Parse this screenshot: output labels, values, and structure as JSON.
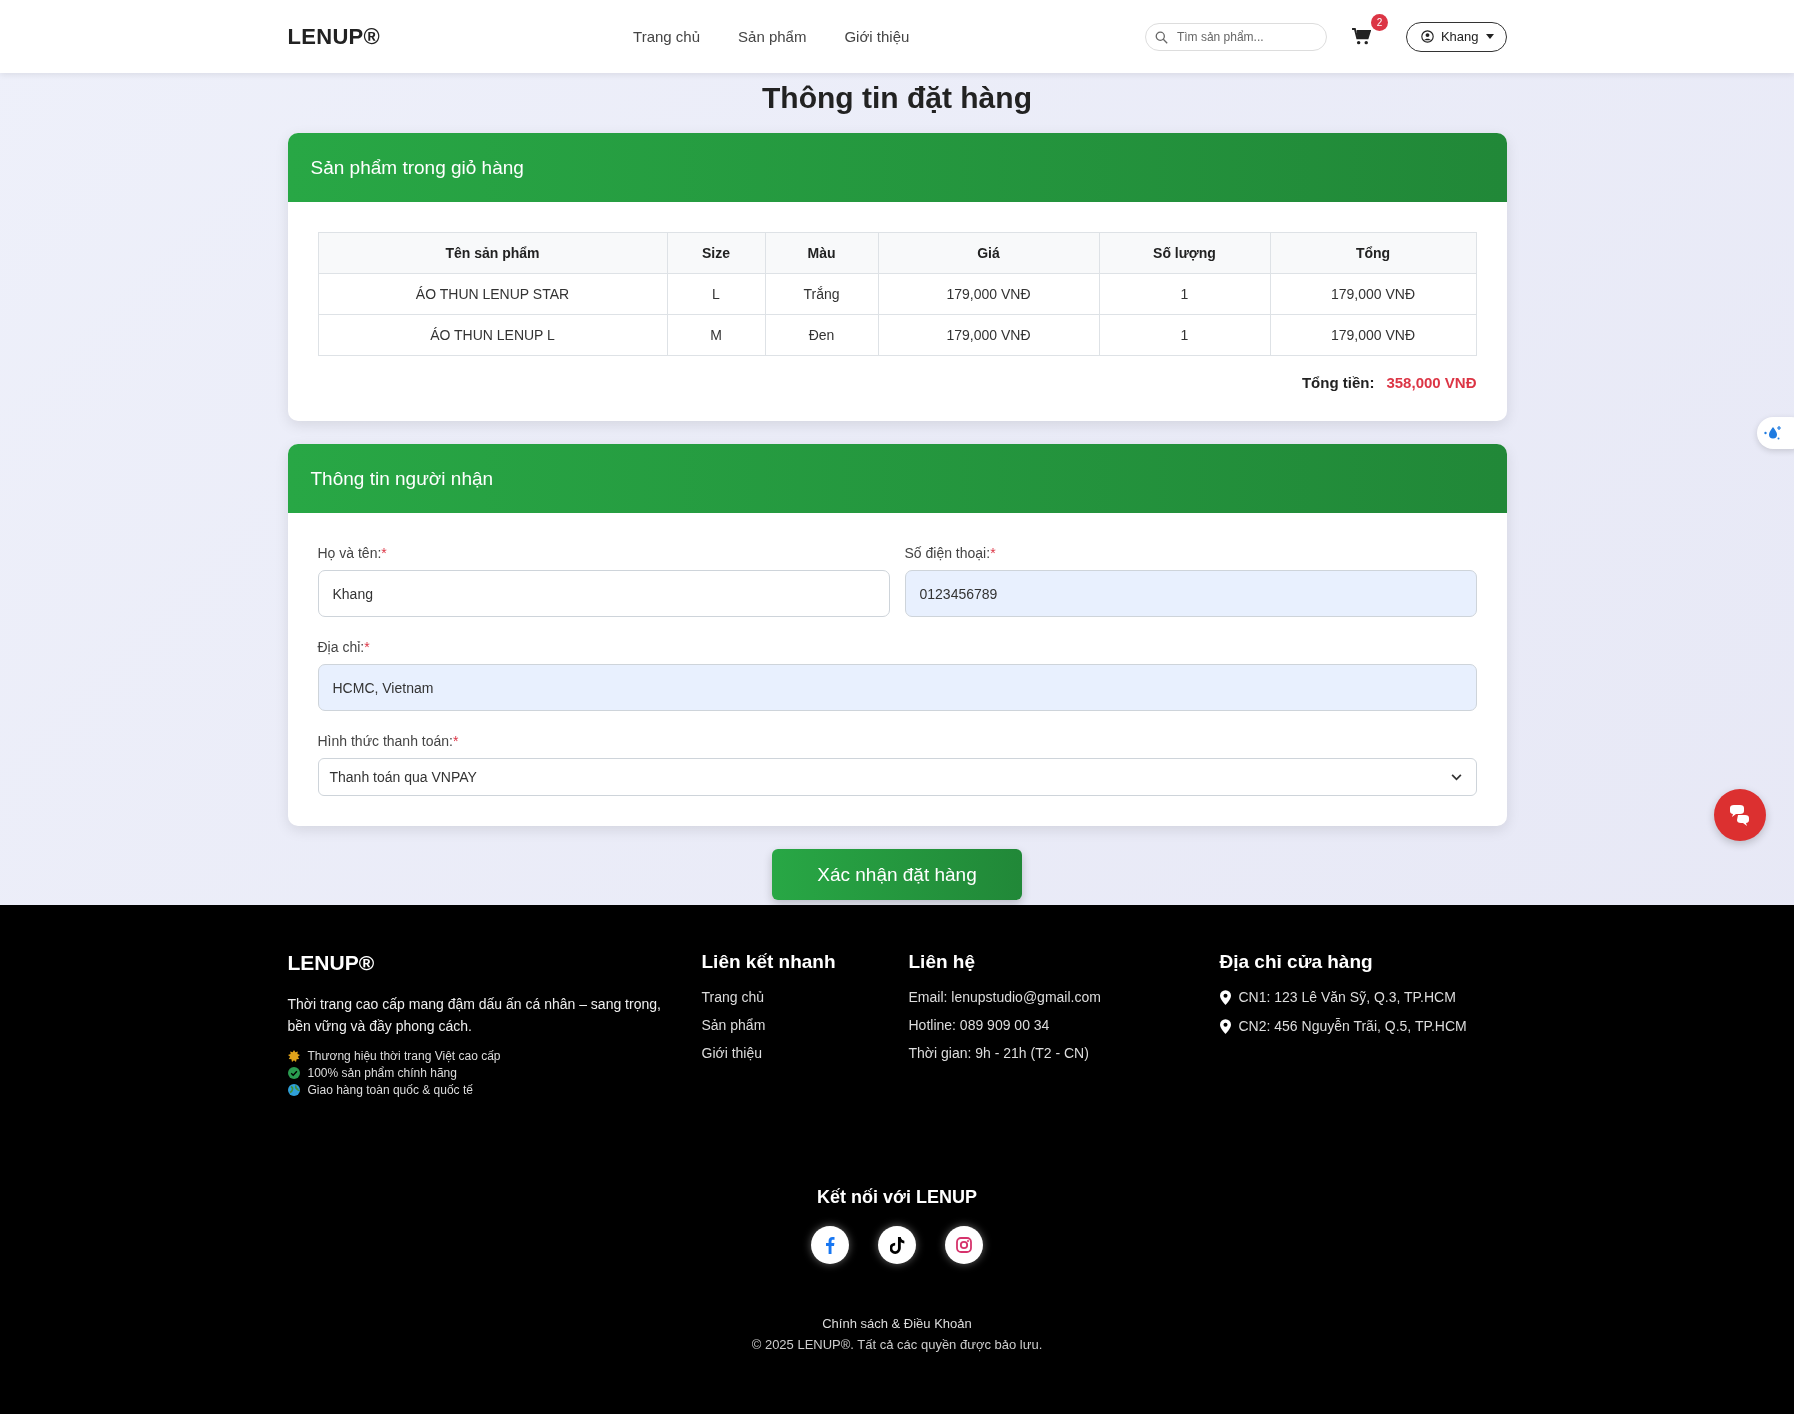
{
  "header": {
    "logo": "LENUP®",
    "nav": [
      {
        "label": "Trang chủ"
      },
      {
        "label": "Sản phẩm"
      },
      {
        "label": "Giới thiệu"
      }
    ],
    "search": {
      "placeholder": "Tìm sản phẩm..."
    },
    "cart_count": "2",
    "user": "Khang"
  },
  "page_title": "Thông tin đặt hàng",
  "cart": {
    "title": "Sản phẩm trong giỏ hàng",
    "table": {
      "columns": [
        "Tên sản phẩm",
        "Size",
        "Màu",
        "Giá",
        "Số lượng",
        "Tổng"
      ],
      "rows": [
        [
          "ÁO THUN LENUP STAR",
          "L",
          "Trắng",
          "179,000 VNĐ",
          "1",
          "179,000 VNĐ"
        ],
        [
          "ÁO THUN LENUP L",
          "M",
          "Đen",
          "179,000 VNĐ",
          "1",
          "179,000 VNĐ"
        ]
      ]
    },
    "total_label": "Tổng tiền:",
    "total_value": "358,000 VNĐ"
  },
  "recipient": {
    "title": "Thông tin người nhận",
    "fields": [
      {
        "kind": "input",
        "label": "Họ và tên:",
        "required_mark": "*",
        "value": "Khang",
        "autofilled": false
      },
      {
        "kind": "input",
        "label": "Số điện thoại:",
        "required_mark": "*",
        "value": "0123456789",
        "autofilled": true
      },
      {
        "kind": "input",
        "label": "Địa chỉ:",
        "required_mark": "*",
        "value": "HCMC, Vietnam",
        "autofilled": true
      },
      {
        "kind": "select",
        "label": "Hình thức thanh toán:",
        "required_mark": "*",
        "value": "Thanh toán qua VNPAY",
        "autofilled": false
      }
    ]
  },
  "submit": "Xác nhận đặt hàng",
  "footer": {
    "logo": "LENUP®",
    "about": "Thời trang cao cấp mang đậm dấu ấn cá nhân – sang trọng, bền vững và đầy phong cách.",
    "highlights": [
      {
        "kind": "star",
        "text": "Thương hiệu thời trang Việt cao cấp"
      },
      {
        "kind": "check",
        "text": "100% sản phẩm chính hãng"
      },
      {
        "kind": "globe",
        "text": "Giao hàng toàn quốc & quốc tế"
      }
    ],
    "links_title": "Liên kết nhanh",
    "links": [
      "Trang chủ",
      "Sản phẩm",
      "Giới thiệu"
    ],
    "contact_title": "Liên hệ",
    "contact": [
      "Email: lenupstudio@gmail.com",
      "Hotline: 089 909 00 34",
      "Thời gian: 9h - 21h (T2 - CN)"
    ],
    "stores_title": "Địa chỉ cửa hàng",
    "stores": [
      "CN1: 123 Lê Văn Sỹ, Q.3, TP.HCM",
      "CN2: 456 Nguyễn Trãi, Q.5, TP.HCM"
    ],
    "connect_title": "Kết nối với LENUP",
    "socials": [
      {
        "kind": "facebook"
      },
      {
        "kind": "tiktok"
      },
      {
        "kind": "instagram"
      }
    ],
    "policy": "Chính sách & Điều Khoản",
    "copyright": "© 2025 LENUP®. Tất cả các quyền được bảo lưu."
  }
}
